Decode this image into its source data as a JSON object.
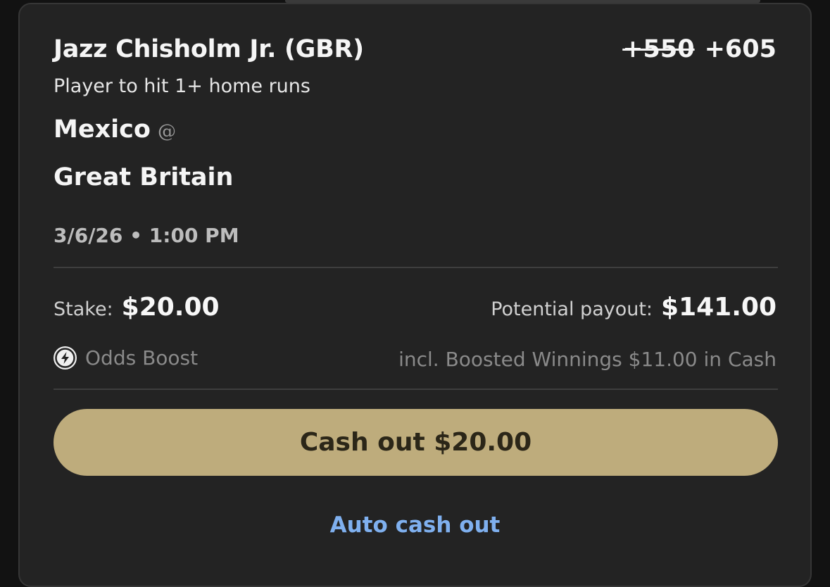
{
  "bet": {
    "player": "Jazz Chisholm Jr. (GBR)",
    "old_odds": "+550",
    "new_odds": "+605",
    "market": "Player to hit 1+ home runs",
    "away_team": "Mexico",
    "at_symbol": "@",
    "home_team": "Great Britain",
    "datetime": "3/6/26 • 1:00 PM"
  },
  "wager": {
    "stake_label": "Stake:",
    "stake_value": "$20.00",
    "payout_label": "Potential payout:",
    "payout_value": "$141.00"
  },
  "boost": {
    "label": "Odds Boost",
    "icon": "lightning-bolt-icon",
    "note": "incl. Boosted Winnings $11.00 in Cash"
  },
  "actions": {
    "cashout_label": "Cash out $20.00",
    "auto_cashout_label": "Auto cash out"
  },
  "colors": {
    "card_bg": "#232323",
    "cashout_button": "#beac7c",
    "link": "#7fb0ef"
  }
}
